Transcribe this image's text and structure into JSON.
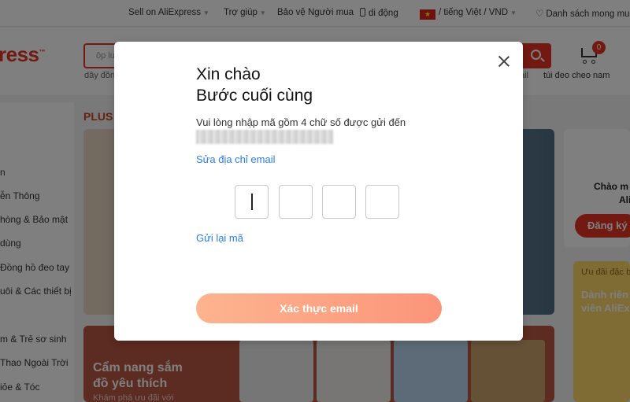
{
  "topbar": {
    "sell": "Sell on AliExpress",
    "help": "Trợ giúp",
    "buyer_protection": "Bảo vệ Người mua",
    "mobile": "di động",
    "locale": "/ tiếng Việt / VND",
    "wishlist": "Danh sách mong muốn"
  },
  "header": {
    "logo": "ress",
    "search_placeholder": "ộp lư",
    "hot_word": "dây đồn",
    "hot_word_right": "ail",
    "cart_label": "túi đeo cheo nam",
    "cart_count": "0"
  },
  "sidebar": {
    "items": [
      "n",
      "ễn Thông",
      "hòng & Bảo mật",
      "dùng",
      "Đồng hồ đeo tay",
      "uôi & Các thiết bị",
      "",
      "m & Trẻ sơ sinh",
      "Thao Ngoài Trời",
      "iỏe & Tóc"
    ]
  },
  "main": {
    "plus_label": "PLUS",
    "promo_title_line1": "Cẩm nang sắm",
    "promo_title_line2": "đồ yêu thích",
    "promo_sub": "Khám phá ưu đãi với"
  },
  "right": {
    "hello": "Chào m",
    "brand": "Ali",
    "register": "Đăng ký",
    "deal_tag": "Ưu đãi đặc b",
    "deal_line1": "Dành riên",
    "deal_line2": "viên AliEx"
  },
  "modal": {
    "title_line1": "Xin chào",
    "title_line2": "Bước cuối cùng",
    "description": "Vui lòng nhập mã gồm 4 chữ số được gửi đến",
    "edit_email": "Sửa địa chỉ email",
    "code_digits": [
      "",
      "",
      "",
      ""
    ],
    "resend": "Gửi lại mã",
    "verify_button": "Xác thực email"
  },
  "colors": {
    "brand": "#e43225",
    "link": "#2b7de9",
    "verify_button": "#fca585"
  }
}
